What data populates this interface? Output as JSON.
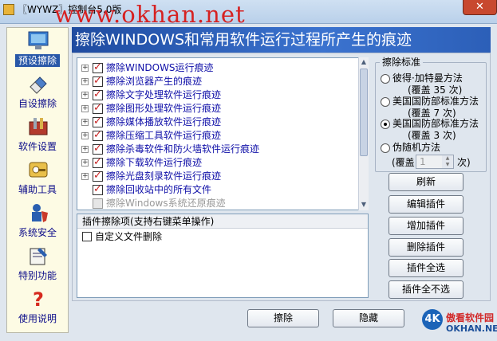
{
  "window": {
    "title": "〖WYWZ〗控制台5.0版",
    "watermark": "www.okhan.net",
    "close_label": "✕"
  },
  "sidebar": {
    "items": [
      {
        "label": "预设擦除",
        "icon": "monitor-icon",
        "active": true
      },
      {
        "label": "自设擦除",
        "icon": "eraser-icon"
      },
      {
        "label": "软件设置",
        "icon": "tools-icon"
      },
      {
        "label": "辅助工具",
        "icon": "key-icon"
      },
      {
        "label": "系统安全",
        "icon": "shield-user-icon"
      },
      {
        "label": "特别功能",
        "icon": "notepad-icon"
      },
      {
        "label": "使用说明",
        "icon": "question-icon"
      }
    ]
  },
  "banner": {
    "title": "擦除WINDOWS和常用软件运行过程所产生的痕迹"
  },
  "tree": {
    "items": [
      {
        "label": "擦除WINDOWS运行痕迹",
        "expander": true,
        "checked": true
      },
      {
        "label": "擦除浏览器产生的痕迹",
        "expander": true,
        "checked": true
      },
      {
        "label": "擦除文字处理软件运行痕迹",
        "expander": true,
        "checked": true
      },
      {
        "label": "擦除图形处理软件运行痕迹",
        "expander": true,
        "checked": true
      },
      {
        "label": "擦除媒体播放软件运行痕迹",
        "expander": true,
        "checked": true
      },
      {
        "label": "擦除压缩工具软件运行痕迹",
        "expander": true,
        "checked": true
      },
      {
        "label": "擦除杀毒软件和防火墙软件运行痕迹",
        "expander": true,
        "checked": true
      },
      {
        "label": "擦除下载软件运行痕迹",
        "expander": true,
        "checked": true
      },
      {
        "label": "擦除光盘刻录软件运行痕迹",
        "expander": true,
        "checked": true
      },
      {
        "label": "擦除回收站中的所有文件",
        "expander": false,
        "checked": true
      },
      {
        "label": "擦除Windows系统还原痕迹",
        "expander": false,
        "checked": false
      }
    ]
  },
  "plugins": {
    "header": "插件擦除项(支持右键菜单操作)",
    "items": [
      {
        "label": "自定义文件删除",
        "checked": false
      }
    ]
  },
  "erase_standard": {
    "title": "擦除标准",
    "options": [
      {
        "label": "彼得·加特曼方法",
        "sub": "(覆盖 35 次)",
        "selected": false
      },
      {
        "label": "美国国防部标准方法",
        "sub": "(覆盖 7 次)",
        "selected": false
      },
      {
        "label": "美国国防部标准方法",
        "sub": "(覆盖 3 次)",
        "selected": true
      },
      {
        "label": "伪随机方法",
        "sub": "",
        "selected": false
      }
    ],
    "random_prefix": "(覆盖",
    "random_value": "1",
    "random_suffix": "次)"
  },
  "buttons": {
    "refresh": "刷新",
    "edit_plugin": "编辑插件",
    "add_plugin": "增加插件",
    "delete_plugin": "删除插件",
    "select_all": "插件全选",
    "select_none": "插件全不选",
    "erase": "擦除",
    "hide": "隐藏"
  },
  "logo": {
    "mark": "4K",
    "cn": "傲看软件园",
    "en": "OKHAN.NET"
  },
  "colors": {
    "banner": "#2c5fb8",
    "link_text": "#1010a8",
    "check_mark": "#c62020",
    "watermark": "#d62121"
  }
}
